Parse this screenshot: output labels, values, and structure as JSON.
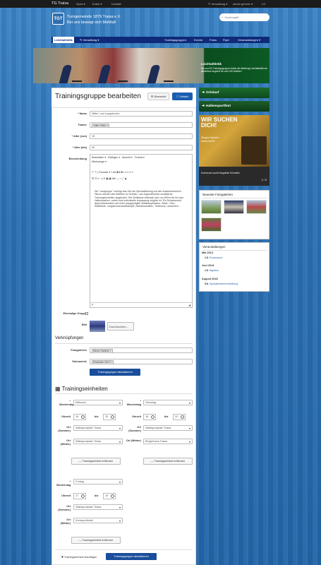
{
  "topbar": {
    "brand": "TG Traisa",
    "menu": [
      "Sport ▾",
      "Kultur ▾",
      "Kontakt"
    ],
    "right": [
      "✎ Verwaltung ▾",
      "admin generic ▾",
      "LG"
    ]
  },
  "header": {
    "logo_text": "TGT",
    "title": "Turngemeinde 1879 Traisa e.V.",
    "subtitle": "Bei uns bewegt sich Mühltal!",
    "search_placeholder": "Suchbegriff..."
  },
  "nav": {
    "left": [
      {
        "label": "Leichtathletik"
      },
      {
        "label": "✎ Verwaltung ▾"
      }
    ],
    "right": [
      "Trainingsgruppen",
      "Events",
      "Fotos",
      "Flyer",
      "Veranstaltungen ▾"
    ]
  },
  "banner": {
    "title": "Leichtathletik",
    "text": "Mit rund 20 Trainingsgruppen bietet die Abteilung Leichtathletik ein attraktives Angebot für rund 200 Athleten"
  },
  "page": {
    "title": "Trainingsgruppe bearbeiten",
    "overview_label": "Übersicht",
    "detail_label": "Details"
  },
  "form": {
    "name_label": "* Name",
    "name_value": "Mittel- und Langstrecke",
    "trainer_label": "Trainer",
    "trainer_tag": "Julien Seitz ×",
    "age_from_label": "* Alter (von)",
    "age_from_value": "15",
    "age_to_label": "* Alter (bis)",
    "age_to_value": "30",
    "desc_label": "Beschreibung",
    "editor_menu": [
      "Bearbeiten ▾",
      "Einfügen ▾",
      "Ansicht ▾",
      "Format ▾",
      "Werkzeuge ▾"
    ],
    "editor_formats": "Formate ▾",
    "editor_text": "Die \"Laufgruppe\" verfolgt das Ziel der Spezialisierung auf den Ausdauerbereich. Hierzu werden den Athleten im Schüler- und Jugendbereich zusätzliche Trainingseinheiten angeboten. Die Zielklasse erstreckt sich von 800m bis hin zum Halbmarathon, wobei eine individuelle Anpassung möglich ist. Ein Schwerpunkt liegt insbesondere auf einer ausgeprägten Wettkampfsaison, Stadt-, Orts-, Stadtläufe, Langstreckenwettkämpfe, Meisterschaften, Triathlons, Laufserien...",
    "editor_footer": "P",
    "former_label": "Ehemalige Gruppe",
    "image_label": "Bild",
    "upload_label": "Durchsuchen...",
    "links_heading": "Verknüpfungen",
    "gallery_label": "Fotogalerien",
    "gallery_tag": "Meine Gallerie ×",
    "docs_label": "Dokumente",
    "docs_tag": "Rückblick 2013 ×",
    "update_btn": "Trainingsgruppe aktualisieren"
  },
  "sessions": {
    "heading": "Trainingseinheiten",
    "labels": {
      "weekday": "* Wochentag",
      "time": "Uhrzeit",
      "until": "bis",
      "place_summer": "Ort (Sommer)",
      "place_winter": "Ort (Winter)"
    },
    "remove_label": "— Trainingseinheit entfernen",
    "items": [
      {
        "weekday": "Mittwoch",
        "from": "18",
        "to": "20",
        "summer": "Waldsportplatz Traisa",
        "winter": "Waldsportplatz Traisa"
      },
      {
        "weekday": "Dienstag",
        "from": "18",
        "to": "20",
        "summer": "Waldsportplatz Traisa",
        "winter": "Bürgerhaus Traisa"
      },
      {
        "weekday": "Freitag",
        "from": "17",
        "to": "19",
        "summer": "Waldsportplatz Traisa",
        "winter": "Kreissporthalle"
      }
    ],
    "add_label": "✚ Trainingseinheit hinzufügen",
    "save_label": "Trainingsgruppe aktualisieren"
  },
  "sidebar": {
    "ortslauf": "Ortslauf",
    "hallensportfest": "Hallensportfest",
    "promo_big": "WIR SUCHEN DICH!",
    "promo_small": "Singen Spielen Instrument?",
    "promo_caption": "Karneval sucht begabte Künstler",
    "promo_pager": "2 / 5",
    "galleries_title": "Neueste Fotogalerien",
    "events_title": "Veranstaltungen",
    "events": [
      {
        "month": "Mai 2014",
        "day": "1.5.",
        "name": "Powerwood"
      },
      {
        "month": "Juni 2014",
        "day": "1.6.",
        "name": "Nightrun"
      },
      {
        "month": "August 2018",
        "day": "5.8.",
        "name": "Sportabzeichenverleihung"
      }
    ]
  },
  "colors": {
    "nav": "#0e2a78",
    "primary": "#1a5db0",
    "side_green": "#1b6b2d"
  }
}
